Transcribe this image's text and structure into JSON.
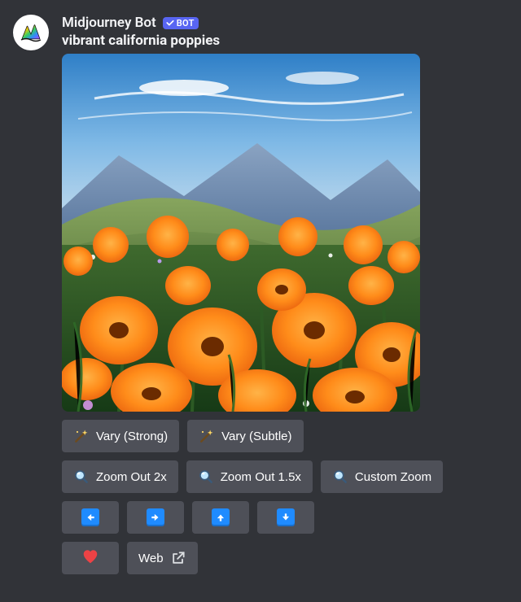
{
  "author": {
    "name": "Midjourney Bot",
    "badge": "BOT"
  },
  "prompt": "vibrant california poppies",
  "buttons": {
    "row1": [
      {
        "label": "Vary (Strong)",
        "icon": "wand-sparkle"
      },
      {
        "label": "Vary (Subtle)",
        "icon": "wand-sparkle"
      }
    ],
    "row2": [
      {
        "label": "Zoom Out 2x",
        "icon": "magnifier"
      },
      {
        "label": "Zoom Out 1.5x",
        "icon": "magnifier"
      },
      {
        "label": "Custom Zoom",
        "icon": "magnifier"
      }
    ],
    "row3": [
      {
        "icon": "arrow-left"
      },
      {
        "icon": "arrow-right"
      },
      {
        "icon": "arrow-up"
      },
      {
        "icon": "arrow-down"
      }
    ],
    "row4": [
      {
        "icon": "heart"
      },
      {
        "label": "Web",
        "icon": "external-link"
      }
    ]
  }
}
